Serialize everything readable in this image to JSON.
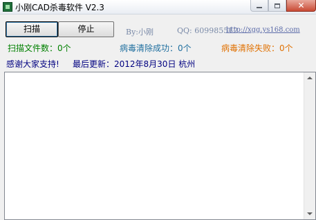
{
  "window": {
    "title": "小刚CAD杀毒软件 V2.3"
  },
  "toolbar": {
    "scan_label": "扫描",
    "stop_label": "停止",
    "author": "By:小刚",
    "qq": "QQ: 609985512",
    "website": "http://xgg.ys168.com"
  },
  "status": {
    "scanned": "扫描文件数：0个",
    "cleaned": "病毒清除成功：0个",
    "failed": "病毒清除失败：0个"
  },
  "info": {
    "thanks": "感谢大家支持!",
    "last_update": "最后更新：2012年8月30日  杭州"
  },
  "colors": {
    "scanned": "#008000",
    "cleaned": "#1f6f9f",
    "failed": "#e07000",
    "info": "#000080"
  }
}
